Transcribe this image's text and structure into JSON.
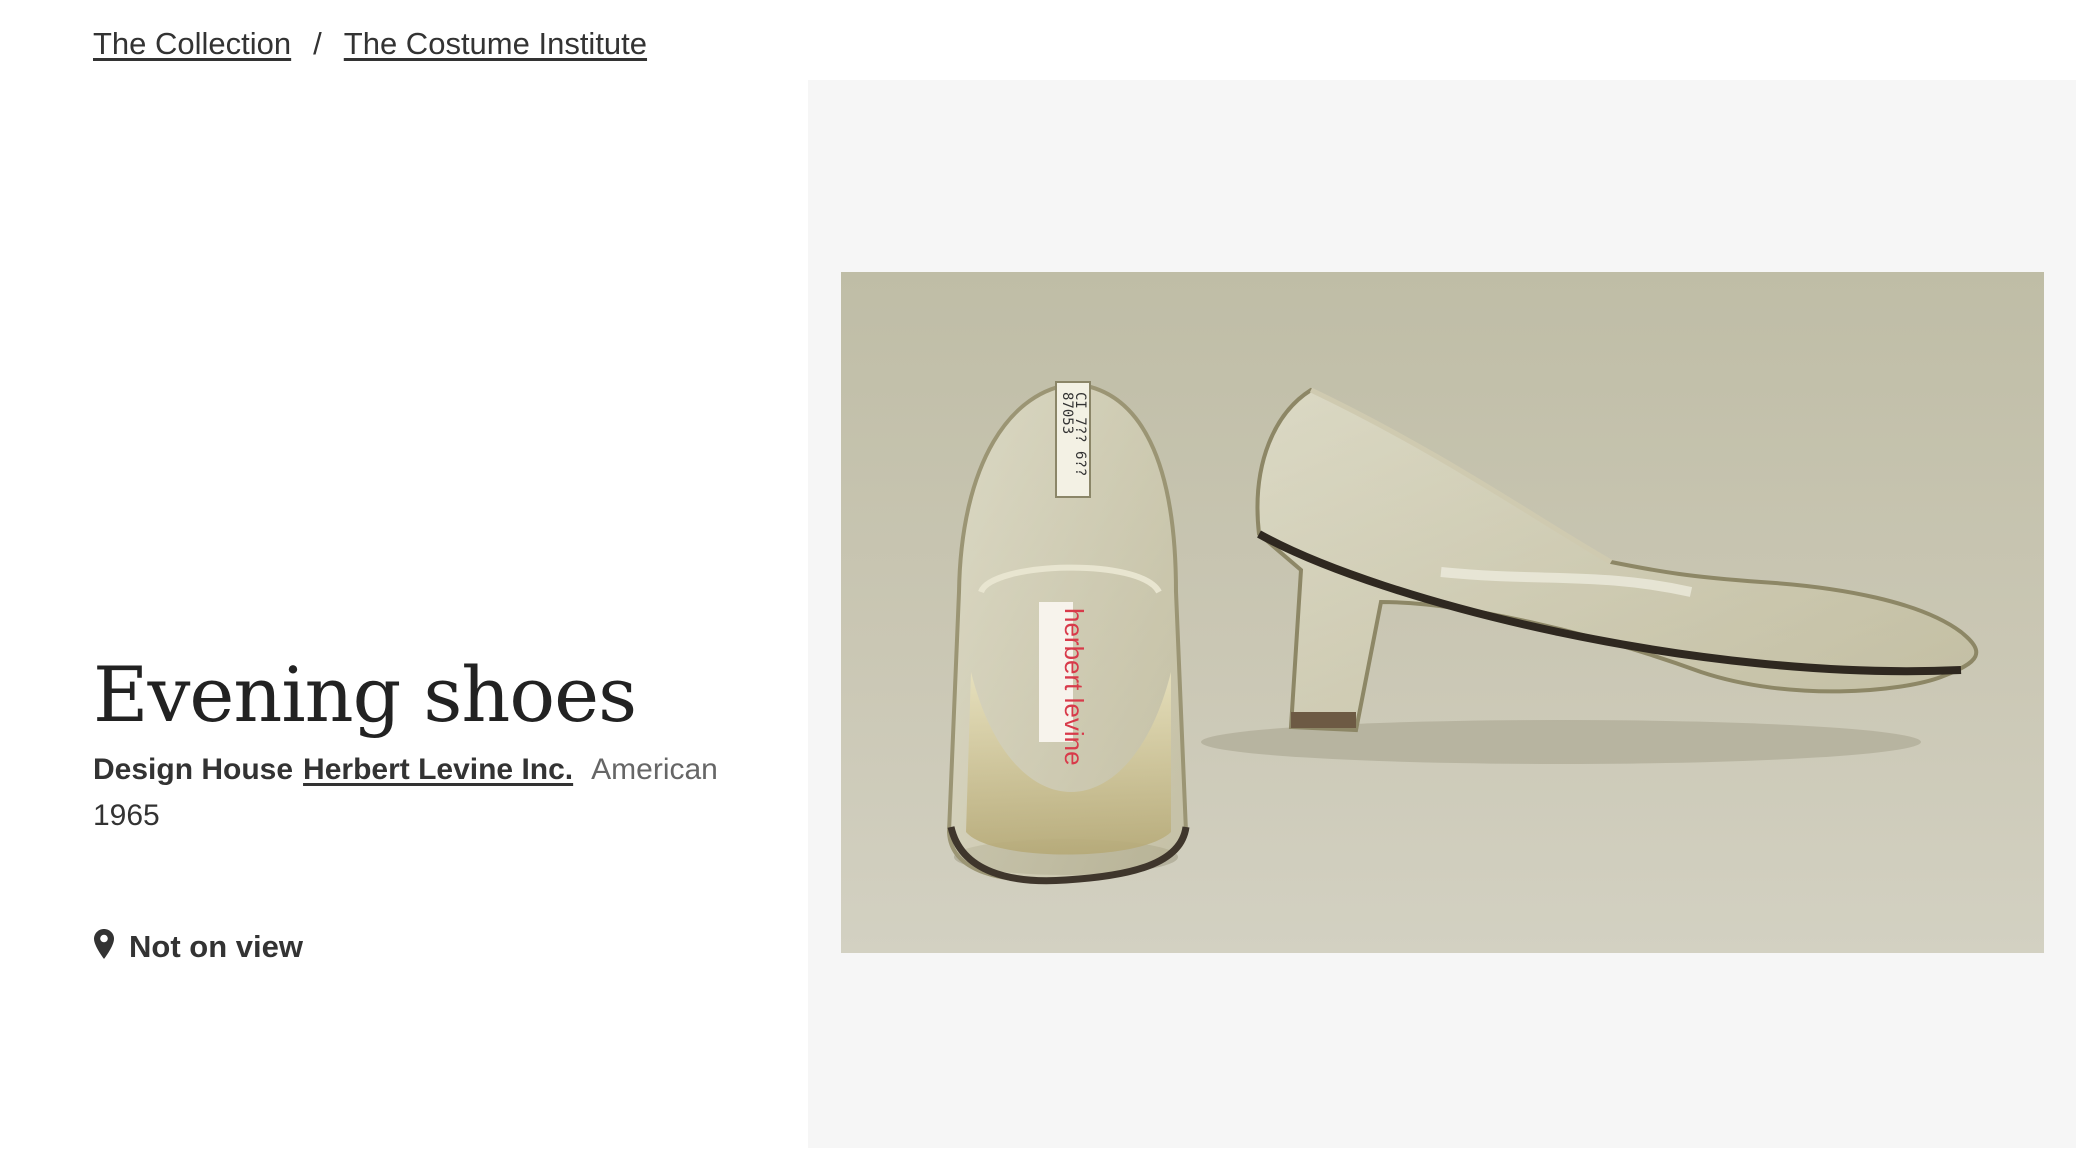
{
  "breadcrumb": {
    "items": [
      "The Collection",
      "The Costume Institute"
    ],
    "separator": "/"
  },
  "object": {
    "title": "Evening shoes",
    "role": "Design House",
    "maker": "Herbert Levine Inc.",
    "culture": "American",
    "date": "1965",
    "location_status": "Not on view",
    "location_icon": "map-pin-icon",
    "image_alt": "Evening shoes"
  },
  "photo": {
    "insole_brand": "herbert levine",
    "tag_lines": [
      "CI 7?? 6??",
      "87053"
    ]
  }
}
